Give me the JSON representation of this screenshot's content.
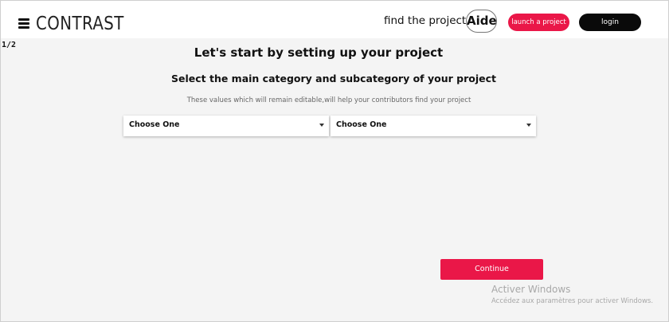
{
  "header": {
    "logo": "CONTRAST",
    "find_projects": "find the projects",
    "aide": "Aide",
    "launch_project": "launch a project",
    "login": "login"
  },
  "main": {
    "step": "1/2",
    "title": "Let's start by setting up your project",
    "subtitle": "Select the main category and subcategory of your project",
    "hint": "These values which will remain editable,will help your contributors find your project",
    "category_select": {
      "value": "Choose One"
    },
    "subcategory_select": {
      "value": "Choose One"
    },
    "continue": "Continue"
  },
  "watermark": {
    "title": "Activer Windows",
    "subtitle": "Accédez aux paramètres pour activer Windows."
  },
  "colors": {
    "accent": "#ea1748",
    "dark_button": "#0a0a0a",
    "background": "#f4f4f4"
  }
}
